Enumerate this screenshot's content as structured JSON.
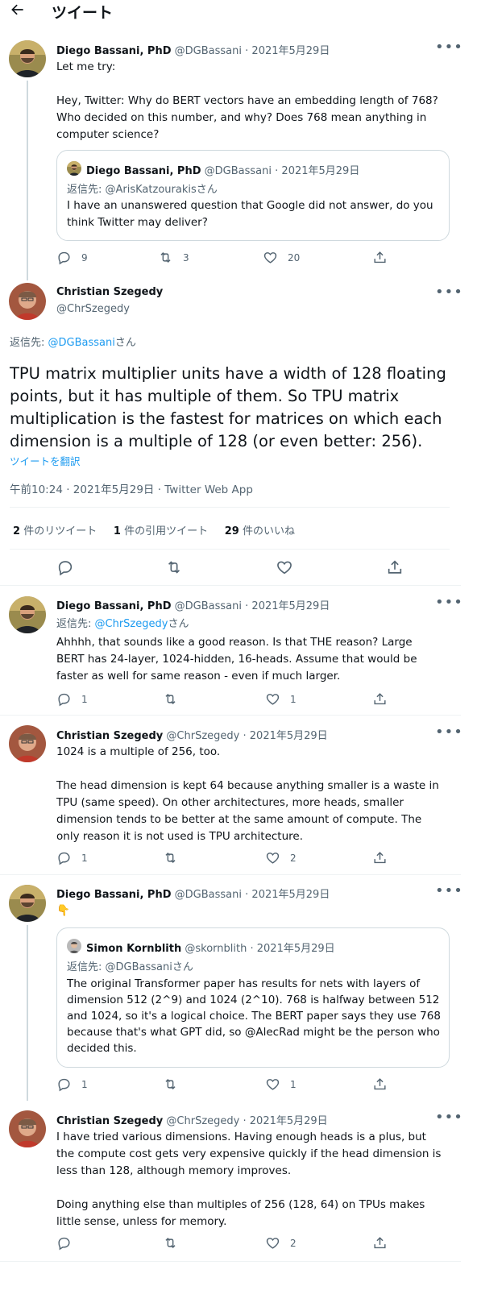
{
  "header": {
    "title": "ツイート"
  },
  "tweets": [
    {
      "name": "Diego Bassani, PhD",
      "handle": "@DGBassani",
      "date": "2021年5月29日",
      "text": "Let me try:\n\nHey, Twitter: Why do BERT vectors have an embedding length of 768? Who decided on this number, and why? Does 768 mean anything in computer science?",
      "quote": {
        "name": "Diego Bassani, PhD",
        "handle": "@DGBassani",
        "date": "2021年5月29日",
        "reply_prefix": "返信先: ",
        "reply_handle": "@ArisKatzourakis",
        "reply_suffix": "さん",
        "text": "I have an unanswered question that Google did not answer, do you think Twitter may deliver?"
      },
      "replies": "9",
      "retweets": "3",
      "likes": "20"
    },
    {
      "name": "Diego Bassani, PhD",
      "handle": "@DGBassani",
      "date": "2021年5月29日",
      "reply_prefix": "返信先: ",
      "reply_handle": "@ChrSzegedy",
      "reply_suffix": "さん",
      "text": "Ahhhh, that sounds like a good reason. Is that THE reason? Large BERT has 24-layer, 1024-hidden, 16-heads. Assume that would be faster as well for same reason - even if much larger.",
      "replies": "1",
      "retweets": "",
      "likes": "1"
    },
    {
      "name": "Christian Szegedy",
      "handle": "@ChrSzegedy",
      "date": "2021年5月29日",
      "text": "1024 is a multiple of 256, too.\n\nThe head dimension is kept 64 because anything smaller is a waste in TPU (same speed). On other architectures, more heads, smaller dimension tends to be better at the same amount of compute. The only reason it is not used is TPU architecture.",
      "replies": "1",
      "retweets": "",
      "likes": "2"
    },
    {
      "name": "Diego Bassani, PhD",
      "handle": "@DGBassani",
      "date": "2021年5月29日",
      "text": "👇",
      "quote": {
        "name": "Simon Kornblith",
        "handle": "@skornblith",
        "date": "2021年5月29日",
        "reply_prefix": "返信先: ",
        "reply_handle": "@DGBassani",
        "reply_suffix": "さん",
        "text": "The original Transformer paper has results for nets with layers of dimension 512 (2^9) and 1024 (2^10). 768 is halfway between 512 and 1024, so it's a logical choice. The BERT paper says they use 768 because that's what GPT did, so @AlecRad might be the person who decided this."
      },
      "replies": "1",
      "retweets": "",
      "likes": "1"
    },
    {
      "name": "Christian Szegedy",
      "handle": "@ChrSzegedy",
      "date": "2021年5月29日",
      "text": "I have tried various dimensions. Having enough heads is a plus, but the compute cost gets very expensive quickly if the head dimension is less than 128, although memory improves.\n\nDoing anything else than multiples of 256 (128, 64) on TPUs makes little sense, unless for memory.",
      "replies": "",
      "retweets": "",
      "likes": "2"
    }
  ],
  "main": {
    "name": "Christian Szegedy",
    "handle": "@ChrSzegedy",
    "reply_prefix": "返信先: ",
    "reply_handle": "@DGBassani",
    "reply_suffix": "さん",
    "text": "TPU matrix multiplier units have a width of 128 floating points, but it has multiple of them. So TPU matrix multiplication is the fastest for matrices on which each dimension is a multiple of 128 (or even better: 256).",
    "translate": "ツイートを翻訳",
    "meta": "午前10:24 · 2021年5月29日 · Twitter Web App",
    "stats": {
      "retweets_count": "2",
      "retweets_label": "件のリツイート",
      "quotes_count": "1",
      "quotes_label": "件の引用ツイート",
      "likes_count": "29",
      "likes_label": "件のいいね"
    }
  },
  "icons": {
    "back": "arrow-left",
    "more": "more-dots",
    "reply": "speech-bubble",
    "retweet": "retweet-arrows",
    "like": "heart",
    "share": "share-upload"
  },
  "colors": {
    "accent": "#1d9bf0",
    "muted": "#536471",
    "border": "#cfd9de"
  }
}
